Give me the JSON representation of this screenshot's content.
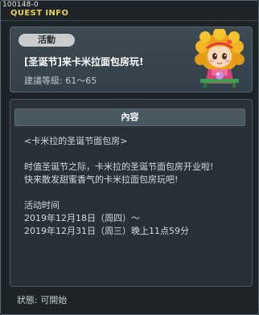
{
  "window": {
    "id_label": "100148-0",
    "title": "QUEST INFO"
  },
  "quest": {
    "tag": "活動",
    "title": "[圣诞节]来卡米拉面包房玩!",
    "level": "建議等級: 61〜65"
  },
  "content": {
    "header": "內容",
    "lines": [
      "<卡米拉的圣诞节面包房>",
      "",
      "时值圣诞节之际，卡米拉的圣诞节面包房开业啦!",
      "快来散发甜蜜香气的卡米拉面包房玩吧!",
      "",
      "活动时间",
      "2019年12月18日（周四）〜",
      "2019年12月31日（周三）晚上11点59分"
    ]
  },
  "status": "狀態: 可開始"
}
